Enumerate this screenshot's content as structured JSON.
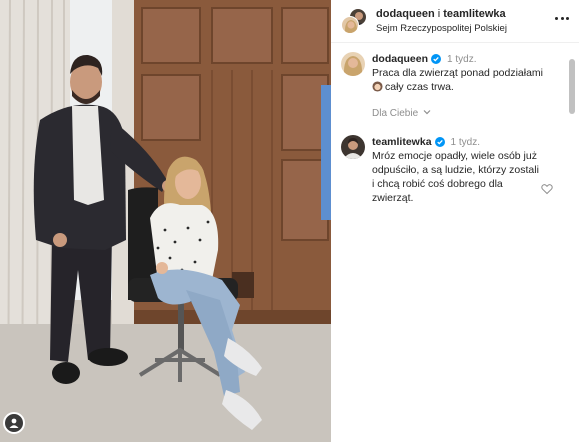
{
  "post": {
    "header": {
      "account_1": "dodaqueen",
      "connector": "i",
      "account_2": "teamlitewka",
      "location": "Sejm Rzeczypospolitej Polskiej"
    },
    "more_icon": "ellipsis-horizontal-icon"
  },
  "comments": [
    {
      "username": "dodaqueen",
      "verified": true,
      "time": "1 tydz.",
      "text_line_1": "Praca dla zwierząt ponad podziałami",
      "emoji": "face-emoji",
      "text_line_2": "cały czas trwa."
    },
    {
      "username": "teamlitewka",
      "verified": true,
      "time": "1 tydz.",
      "text": "Mróz emocje opadły, wiele osób już odpuściło, a są ludzie, którzy zostali i chcą robić coś dobrego dla zwierząt."
    }
  ],
  "replies_toggle": {
    "label": "Dla Ciebie",
    "icon": "chevron-down-icon"
  },
  "like_icon": "heart-outline-icon",
  "colors": {
    "text": "#262626",
    "secondary": "#8e8e8e",
    "verified_blue": "#0095f6",
    "divider": "#efefef"
  }
}
